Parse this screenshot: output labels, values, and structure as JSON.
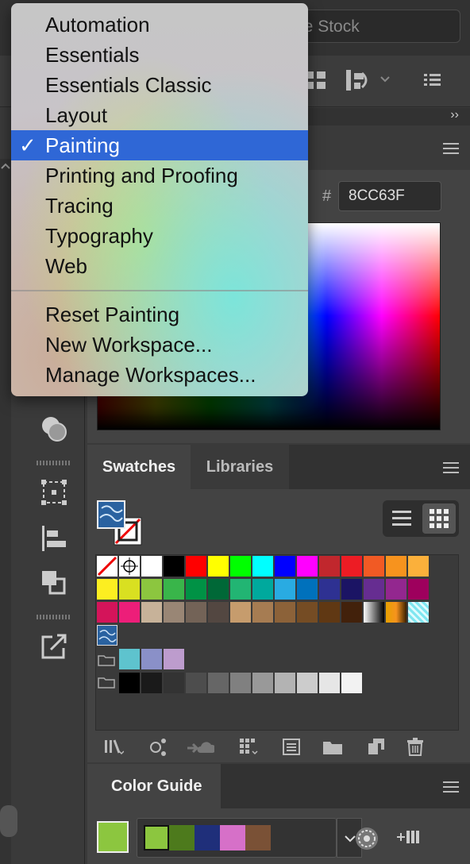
{
  "header": {
    "search_placeholder": "Search Adobe Stock",
    "search_visible": "be Stock",
    "expand_label": "››"
  },
  "workspace_menu": {
    "items": [
      {
        "label": "Automation",
        "selected": false
      },
      {
        "label": "Essentials",
        "selected": false
      },
      {
        "label": "Essentials Classic",
        "selected": false
      },
      {
        "label": "Layout",
        "selected": false
      },
      {
        "label": "Painting",
        "selected": true
      },
      {
        "label": "Printing and Proofing",
        "selected": false
      },
      {
        "label": "Tracing",
        "selected": false
      },
      {
        "label": "Typography",
        "selected": false
      },
      {
        "label": "Web",
        "selected": false
      }
    ],
    "check_glyph": "✓",
    "actions": [
      "Reset Painting",
      "New Workspace...",
      "Manage Workspaces..."
    ]
  },
  "color_panel": {
    "hex_label": "#",
    "hex_value": "8CC63F"
  },
  "swatches_panel": {
    "tabs": [
      "Swatches",
      "Libraries"
    ],
    "active_tab": "Swatches",
    "rows": [
      [
        "none",
        "registration",
        "#ffffff",
        "#000000",
        "#ff0000",
        "#ffff00",
        "#00ff00",
        "#00ffff",
        "#0000ff",
        "#ff00ff",
        "#c1272d",
        "#ed1c24",
        "#f15a24",
        "#f7931e",
        "#fbb03b"
      ],
      [
        "#fcee21",
        "#d9e021",
        "#8cc63f",
        "#39b54a",
        "#009245",
        "#006837",
        "#22b573",
        "#00a99d",
        "#29abe2",
        "#0071bc",
        "#2e3192",
        "#1b1464",
        "#662d91",
        "#93278f",
        "#9e005d"
      ],
      [
        "#d4145a",
        "#ed1e79",
        "#c7b299",
        "#998675",
        "#736357",
        "#534741",
        "#c69c6d",
        "#a67c52",
        "#8c6239",
        "#754c24",
        "#603813",
        "#42210b",
        "gradient-bw",
        "gradient-orange",
        "pattern"
      ],
      [
        "pattern-blue"
      ]
    ],
    "group1": [
      "#5ec3ce",
      "#8a90c8",
      "#bd9ccd"
    ],
    "grays": [
      "#000000",
      "#1a1a1a",
      "#333333",
      "#4d4d4d",
      "#666666",
      "#808080",
      "#999999",
      "#b3b3b3",
      "#cccccc",
      "#e6e6e6",
      "#f2f2f2"
    ]
  },
  "color_guide": {
    "title": "Color Guide",
    "active_color": "#8cc63f",
    "harmony": [
      "#8cc63f",
      "#4d7a1c",
      "#1f2f7a",
      "#d670c8",
      "#7a5136"
    ]
  }
}
